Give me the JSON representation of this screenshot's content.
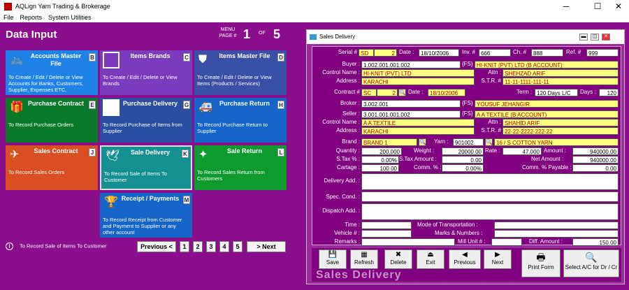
{
  "window": {
    "title": "AQLign Yarn Trading & Brokerage",
    "min": "─",
    "max": "☐",
    "close": "✕"
  },
  "menu": [
    "File",
    "Reports",
    "System Utilities"
  ],
  "page": {
    "title": "Data Input",
    "menu_page_label": "MENU PAGE #",
    "current": "1",
    "of_label": "OF",
    "total": "5"
  },
  "tiles": [
    {
      "title": "Accounts Master File",
      "key": "B",
      "desc": "To Create / Edit / Delete or View Accounts for Banks, Customers, Supplier, Expenses ETC.",
      "icon": "bicycle-icon"
    },
    {
      "title": "Items Brands",
      "key": "C",
      "desc": "To Create / Edit / Delete or View Brands",
      "icon": "brand-box-icon"
    },
    {
      "title": "Items Master File",
      "key": "D",
      "desc": "To Create / Edit / Delete or View Items (Products / Services)",
      "icon": "shield-icon"
    },
    {
      "title": "Purchase Contract",
      "key": "E",
      "desc": "To Record Purchase Orders",
      "icon": "gift-icon"
    },
    {
      "title": "Purchase Delivery",
      "key": "G",
      "desc": "To Record Purchase of Items from Supplier",
      "icon": "blank-box-icon"
    },
    {
      "title": "Purchase Return",
      "key": "H",
      "desc": "To Record Purchase Return to Supplier",
      "icon": "ambulance-icon"
    },
    {
      "title": "Sales Contract",
      "key": "J",
      "desc": "To Record Sales Orders",
      "icon": "plane-icon"
    },
    {
      "title": "Sale Delivery",
      "key": "K",
      "desc": "To Record Sale of Items To Customer",
      "icon": "bird-icon"
    },
    {
      "title": "Sale Return",
      "key": "L",
      "desc": "To Record Sales Return from Customers",
      "icon": "star-icon"
    },
    {
      "title": "Receipt / Payments",
      "key": "M",
      "desc": "To Record Receipt from Customer and Payment to Supplier or any other account",
      "icon": "trophy-icon"
    }
  ],
  "status_info": "To Record Sale of Items To Customer",
  "nav": {
    "previous": "Previous <",
    "pages": [
      "1",
      "2",
      "3",
      "4",
      "5"
    ],
    "next": "> Next"
  },
  "dialog": {
    "title": "Sales Delivery",
    "serial_label": "Serial #",
    "serial_prefix": "SD",
    "serial_no": "2",
    "date_label": "Date :",
    "date": "18/10/2006",
    "inv_label": "Inv. #",
    "inv": "666",
    "ch_label": "Ch. #",
    "ch": "888",
    "ref_label": "Ref. #",
    "ref": "999",
    "buyer_label": "Buyer :",
    "buyer_code": "1.002.001.001.002",
    "fs": "{FS}",
    "buyer_name": "HI-KNIT (PVT) LTD (B ACCOUNT)",
    "control_name_label": "Control Name :",
    "buyer_control": "HI-KNIT (PVT) LTD",
    "attn_label": "Attn :",
    "buyer_attn": "SHEHZAD ARIF",
    "address_label": "Address :",
    "buyer_address": "KARACHI",
    "str_label": "S.T.R. #",
    "buyer_str": "11-11-1111-111-11",
    "contract_label": "Contract #",
    "contract_prefix": "SC",
    "contract_no": "2",
    "contract_date": "18/10/2006",
    "term_label": "Term :",
    "term": "120 Days L/C",
    "days_label": "Days :",
    "days": "120",
    "broker_label": "Broker :",
    "broker_code": "3.002.001",
    "broker_name": "YOUSUF JEHANGIR",
    "seller_label": "Seller :",
    "seller_code": "3.001.001.001.002",
    "seller_name": "A A TEXTILE (B ACCOUNT)",
    "seller_control": "A A TEXTILE",
    "seller_attn": "SHAHID ARIF",
    "seller_address": "KARACHI",
    "seller_str": "22-22-2222-222-22",
    "brand_label": "Brand :",
    "brand": "BRAND 1",
    "yarn_label": "Yarn :",
    "yarn_code": "901002",
    "yarn_name": "16 / S COTTON YARN",
    "quantity_label": "Quantity :",
    "quantity": "200.000",
    "weight_label": "Weight :",
    "weight": "20000.00",
    "rate_label": "Rate :",
    "rate": "47.000",
    "amount_label": "Amount :",
    "amount": "940000.00",
    "stax_label": "S.Tax % :",
    "stax": "0.00%",
    "stax_amount_label": "S.Tax Amount :",
    "stax_amount": "0.00",
    "net_amount_label": "Net Amount :",
    "net_amount": "940000.00",
    "cartage_label": "Cartage :",
    "cartage": "100.00",
    "comm_label": "Comm. % :",
    "comm": "0.00%",
    "comm_payable_label": "Comm. % Payable :",
    "comm_payable": "0.00",
    "delivery_add_label": "Delivery Add. :",
    "spec_cond_label": "Spec. Cond. :",
    "dispatch_add_label": "Dispatch Add. :",
    "time_label": "Time :",
    "transport_label": "Mode of Transportation :",
    "vehicle_label": "Vehicle # :",
    "marks_label": "Marks & Numbers :",
    "remarks_label": "Remarks :",
    "mill_unit_label": "Mill Unit # :",
    "diff_amount_label": "Diff. Amount :",
    "diff_amount": "150.00",
    "buttons": {
      "save": "Save",
      "refresh": "Refresh",
      "delete": "Delete",
      "exit": "Exit",
      "previous": "Previous",
      "next": "Next",
      "print": "Print Form",
      "select_ac": "Select A/C for Dr / Cr"
    },
    "watermark": "Sales Delivery"
  },
  "colors": {
    "background": "#8b0f8c",
    "field_yellow": "#ffff80",
    "field_text_red": "#b00000"
  }
}
